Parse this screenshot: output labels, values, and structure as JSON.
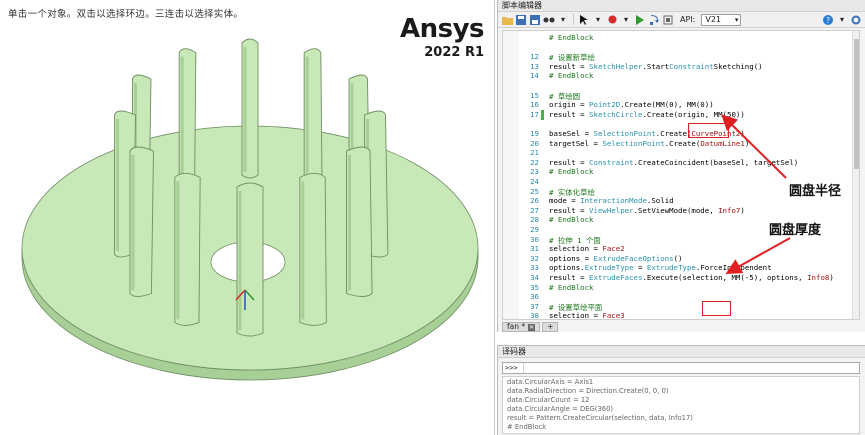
{
  "viewport": {
    "hint": "单击一个对象。双击以选择环边。三连击以选择实体。",
    "brand_name": "Ansys",
    "brand_version": "2022 R1",
    "model_colors": {
      "fill": "#c9e8b8",
      "shade": "#a8cf96",
      "edge": "#6f8f63"
    }
  },
  "editor": {
    "title": "脚本编辑器",
    "api_label": "API:",
    "api_value": "V21",
    "lines": [
      {
        "n": "",
        "t": "# EndBlock",
        "cls": "cm"
      },
      {
        "n": "",
        "t": "",
        "cls": ""
      },
      {
        "n": "12",
        "t": "# 设置新草绘",
        "cls": "cm"
      },
      {
        "n": "13",
        "t": "result = SketchHelper.StartConstraintSketching()",
        "cls": ""
      },
      {
        "n": "14",
        "t": "# EndBlock",
        "cls": "cm"
      },
      {
        "n": "",
        "t": "",
        "cls": ""
      },
      {
        "n": "15",
        "t": "# 草绘圆",
        "cls": "cm"
      },
      {
        "n": "16",
        "t": "origin = Point2D.Create(MM(0), MM(0))",
        "cls": ""
      },
      {
        "n": "17",
        "t": "result = SketchCircle.Create(origin, MM(50))",
        "cls": ""
      },
      {
        "n": "",
        "t": "",
        "cls": ""
      },
      {
        "n": "19",
        "t": "baseSel = SelectionPoint.Create(CurvePoint2)",
        "cls": ""
      },
      {
        "n": "20",
        "t": "targetSel = SelectionPoint.Create(DatumLine1)",
        "cls": ""
      },
      {
        "n": "21",
        "t": "",
        "cls": ""
      },
      {
        "n": "22",
        "t": "result = Constraint.CreateCoincident(baseSel, targetSel)",
        "cls": ""
      },
      {
        "n": "23",
        "t": "# EndBlock",
        "cls": "cm"
      },
      {
        "n": "24",
        "t": "",
        "cls": ""
      },
      {
        "n": "25",
        "t": "# 实体化草绘",
        "cls": "cm"
      },
      {
        "n": "26",
        "t": "mode = InteractionMode.Solid",
        "cls": ""
      },
      {
        "n": "27",
        "t": "result = ViewHelper.SetViewMode(mode, Info7)",
        "cls": ""
      },
      {
        "n": "28",
        "t": "# EndBlock",
        "cls": "cm"
      },
      {
        "n": "29",
        "t": "",
        "cls": ""
      },
      {
        "n": "30",
        "t": "# 拉伸 1 个面",
        "cls": "cm"
      },
      {
        "n": "31",
        "t": "selection = Face2",
        "cls": ""
      },
      {
        "n": "32",
        "t": "options = ExtrudeFaceOptions()",
        "cls": ""
      },
      {
        "n": "33",
        "t": "options.ExtrudeType = ExtrudeType.ForceIndependent",
        "cls": ""
      },
      {
        "n": "34",
        "t": "result = ExtrudeFaces.Execute(selection, MM(-5), options, Info8)",
        "cls": ""
      },
      {
        "n": "35",
        "t": "# EndBlock",
        "cls": "cm"
      },
      {
        "n": "36",
        "t": "",
        "cls": ""
      },
      {
        "n": "37",
        "t": "# 设置草绘平面",
        "cls": "cm"
      },
      {
        "n": "38",
        "t": "selection = Face3",
        "cls": ""
      }
    ],
    "tabs": [
      {
        "label": "fan *"
      },
      {
        "label": "+"
      }
    ]
  },
  "interpreter": {
    "title": "译码器",
    "prompt": ">>>",
    "output": [
      "data.CircularAxis = Axis1",
      "data.RadialDirection = Direction.Create(0, 0, 0)",
      "data.CircularCount = 12",
      "data.CircularAngle = DEG(360)",
      "result = Pattern.CreateCircular(selection, data, Info17)",
      "# EndBlock"
    ]
  },
  "annotations": {
    "radius_label": "圆盘半径",
    "thickness_label": "圆盘厚度",
    "color": "#e02020"
  }
}
